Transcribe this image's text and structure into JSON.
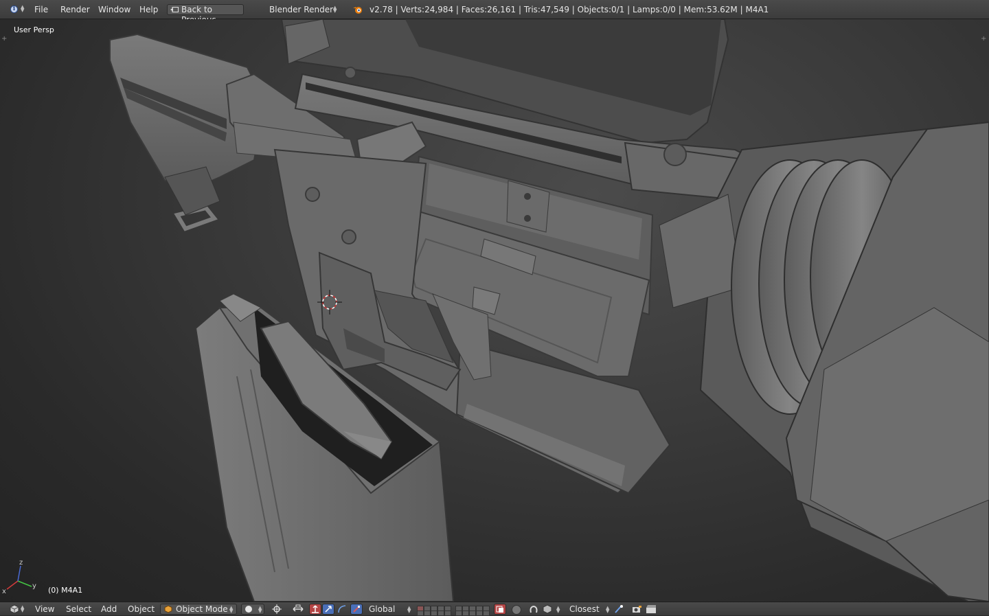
{
  "header": {
    "menu": [
      "File",
      "Render",
      "Window",
      "Help"
    ],
    "back_button": "Back to Previous",
    "render_engine": "Blender Render",
    "stats": "v2.78 | Verts:24,984 | Faces:26,161 | Tris:47,549 | Objects:0/1 | Lamps:0/0 | Mem:53.62M | M4A1"
  },
  "viewport": {
    "view_label": "User Persp",
    "object_label": "(0) M4A1",
    "axis_x": "x",
    "axis_y": "y",
    "axis_z": "z"
  },
  "footer": {
    "menu": [
      "View",
      "Select",
      "Add",
      "Object"
    ],
    "mode": "Object Mode",
    "orientation": "Global",
    "snap_target": "Closest"
  },
  "colors": {
    "header_bg": "#3f3f3f",
    "viewport_bg": "#393939",
    "model_gray": "#6b6b6b",
    "accent_red": "#b03a3a",
    "accent_blue": "#4a7bd4"
  }
}
